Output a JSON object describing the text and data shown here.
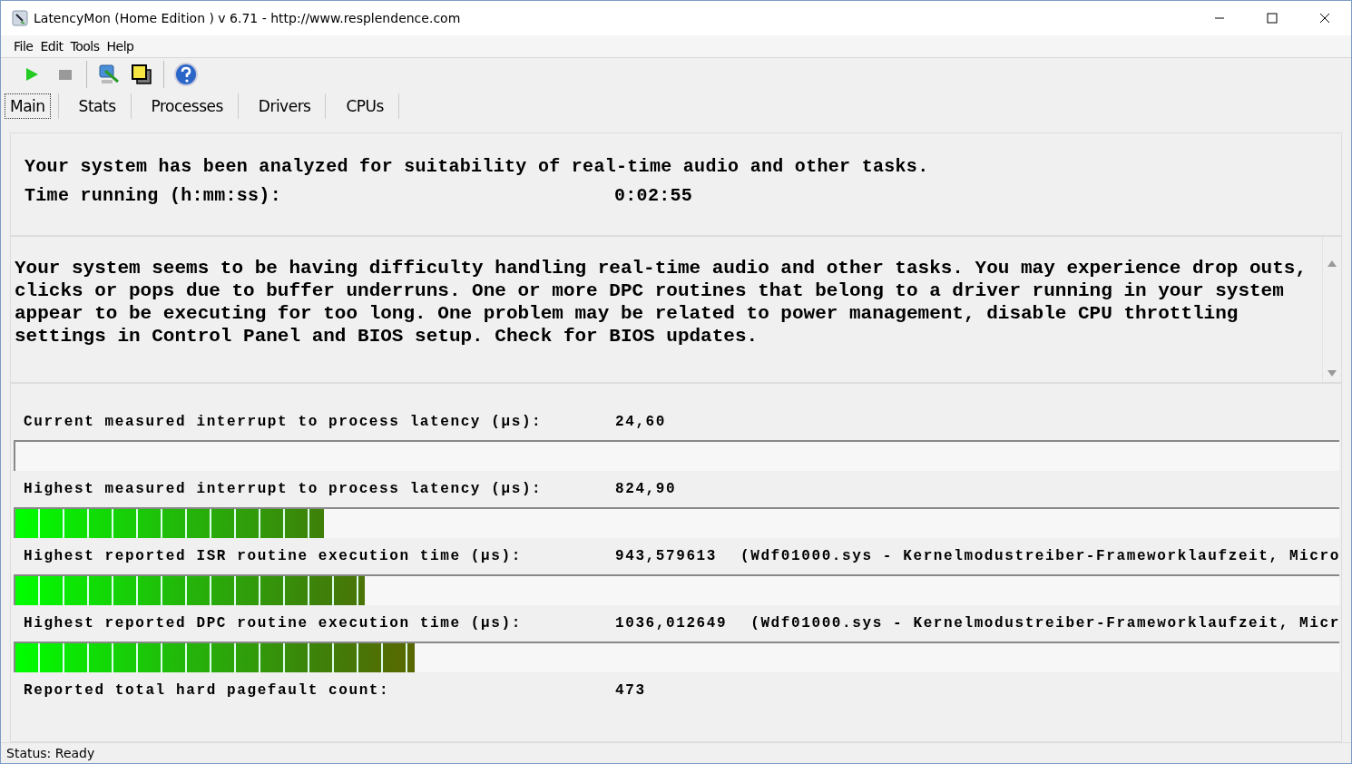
{
  "window": {
    "title": "LatencyMon  (Home Edition )  v 6.71 - http://www.resplendence.com"
  },
  "menu": [
    "File",
    "Edit",
    "Tools",
    "Help"
  ],
  "tabs": [
    {
      "label": "Main",
      "selected": true
    },
    {
      "label": "Stats",
      "selected": false
    },
    {
      "label": "Processes",
      "selected": false
    },
    {
      "label": "Drivers",
      "selected": false
    },
    {
      "label": "CPUs",
      "selected": false
    }
  ],
  "summary": {
    "headline": "Your system has been analyzed for suitability of real-time audio and other tasks.",
    "time_label": "Time running (h:mm:ss):",
    "time_value": "0:02:55"
  },
  "verdict": "Your system seems to be having difficulty handling real-time audio and other tasks. You may experience drop outs, clicks or pops due to buffer underruns. One or more DPC routines that belong to a driver running in your system appear to be executing for too long. One problem may be related to power management, disable CPU throttling settings in Control Panel and BIOS setup. Check for BIOS updates.",
  "measurements": [
    {
      "label": "Current measured interrupt to process latency (µs):",
      "value": "24,60",
      "level": 0
    },
    {
      "label": "Highest measured interrupt to process latency (µs):",
      "value": "824,90",
      "level": 0.2325
    },
    {
      "label": "Highest reported ISR routine execution time (µs):",
      "value": "943,579613",
      "detail": "(Wdf01000.sys - Kernelmodustreiber-Frameworklaufzeit, Micro",
      "level": 0.2635
    },
    {
      "label": "Highest reported DPC routine execution time (µs):",
      "value": "1036,012649",
      "detail": "(Wdf01000.sys - Kernelmodustreiber-Frameworklaufzeit, Micr",
      "level": 0.3012
    },
    {
      "label": "Reported total hard pagefault count:",
      "value": "473"
    }
  ],
  "status_bar": "Status: Ready"
}
